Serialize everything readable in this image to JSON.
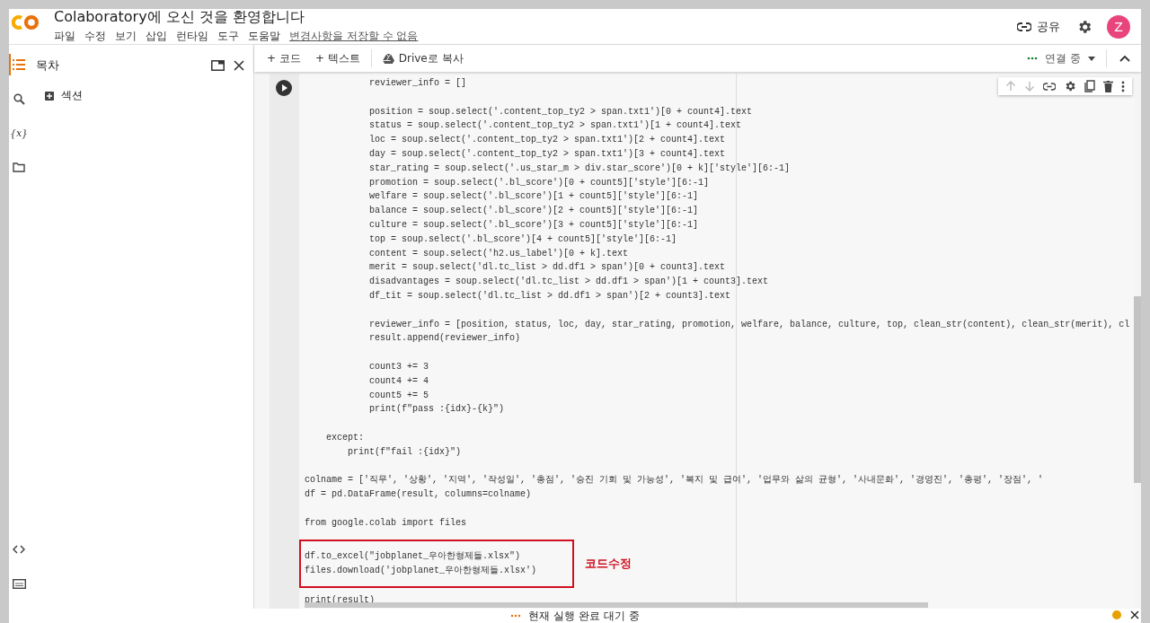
{
  "header": {
    "title": "Colaboratory에 오신 것을 환영합니다",
    "menu": [
      "파일",
      "수정",
      "보기",
      "삽입",
      "런타임",
      "도구",
      "도움말"
    ],
    "save_notice": "변경사항을 저장할 수 없음",
    "share": "공유",
    "avatar": "Z"
  },
  "rail": [
    {
      "kind": "toc",
      "selected": true
    },
    {
      "kind": "search",
      "selected": false
    },
    {
      "kind": "variables",
      "selected": false,
      "label": "{x}"
    },
    {
      "kind": "files",
      "selected": false
    }
  ],
  "rail_bottom": [
    {
      "kind": "code"
    },
    {
      "kind": "terminal"
    }
  ],
  "toc": {
    "title": "목차",
    "items": [
      "섹션"
    ]
  },
  "toolbar": {
    "add_code": "+ 코드",
    "add_text": "+ 텍스트",
    "copy": "Drive로 복사",
    "runtime": "연결 중"
  },
  "cell": {
    "paragraphs": [
      {
        "highlighted": false,
        "lines": [
          "            reviewer_info = []"
        ]
      },
      {
        "highlighted": false,
        "lines": [
          "            position = soup.select('.content_top_ty2 > span.txt1')[0 + count4].text",
          "            status = soup.select('.content_top_ty2 > span.txt1')[1 + count4].text",
          "            loc = soup.select('.content_top_ty2 > span.txt1')[2 + count4].text",
          "            day = soup.select('.content_top_ty2 > span.txt1')[3 + count4].text",
          "            star_rating = soup.select('.us_star_m > div.star_score')[0 + k]['style'][6:-1]",
          "            promotion = soup.select('.bl_score')[0 + count5]['style'][6:-1]",
          "            welfare = soup.select('.bl_score')[1 + count5]['style'][6:-1]",
          "            balance = soup.select('.bl_score')[2 + count5]['style'][6:-1]",
          "            culture = soup.select('.bl_score')[3 + count5]['style'][6:-1]",
          "            top = soup.select('.bl_score')[4 + count5]['style'][6:-1]",
          "            content = soup.select('h2.us_label')[0 + k].text",
          "            merit = soup.select('dl.tc_list > dd.df1 > span')[0 + count3].text",
          "            disadvantages = soup.select('dl.tc_list > dd.df1 > span')[1 + count3].text",
          "            df_tit = soup.select('dl.tc_list > dd.df1 > span')[2 + count3].text"
        ]
      },
      {
        "highlighted": false,
        "lines": [
          "            reviewer_info = [position, status, loc, day, star_rating, promotion, welfare, balance, culture, top, clean_str(content), clean_str(merit), cl",
          "            result.append(reviewer_info)"
        ]
      },
      {
        "highlighted": false,
        "lines": [
          "            count3 += 3",
          "            count4 += 4",
          "            count5 += 5",
          "            print(f\"pass :{idx}-{k}\")"
        ]
      },
      {
        "highlighted": false,
        "lines": [
          "    except:",
          "        print(f\"fail :{idx}\")"
        ]
      },
      {
        "highlighted": false,
        "lines": [
          "colname = ['직무', '상황', '지역', '작성일', '총점', '승진 기회 및 가능성', '복지 및 급여', '업무와 삶의 균형', '사내문화', '경영진', '총평', '장점', '",
          "df = pd.DataFrame(result, columns=colname)"
        ]
      },
      {
        "highlighted": false,
        "lines": [
          "from google.colab import files"
        ]
      },
      {
        "highlighted": true,
        "note": "코드수정",
        "lines": [
          "df.to_excel(\"jobplanet_우아한형제들.xlsx\")",
          "files.download('jobplanet_우아한형제들.xlsx')"
        ]
      },
      {
        "highlighted": false,
        "lines": [
          "print(result)"
        ]
      }
    ]
  },
  "status_bar": {
    "text": "현재 실행 완료 대기 중"
  }
}
